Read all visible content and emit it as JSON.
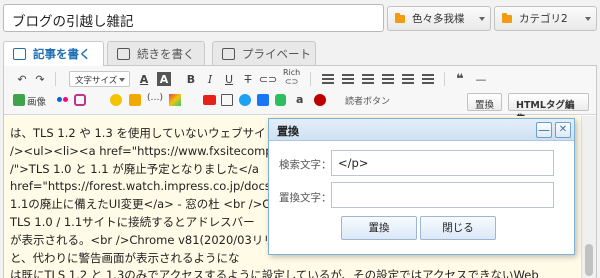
{
  "post": {
    "title": "ブログの引越し雑記"
  },
  "categories": [
    {
      "label": "色々多我楪"
    },
    {
      "label": "カテゴリ2"
    }
  ],
  "tabs": [
    {
      "label": "記事を書く"
    },
    {
      "label": "続きを書く"
    },
    {
      "label": "プライベート"
    }
  ],
  "toolbar": {
    "font_size_label": "文字サイズ",
    "rich_label": "Rich",
    "image_label": "画像",
    "reader_button_label": "読者ボタン",
    "replace_button_label": "置換",
    "html_edit_button_label": "HTMLタグ編集"
  },
  "content_lines": [
    "は、TLS 1.2 や 1.3 を使用していないウェブサイ",
    "/><ul><li><a  href=\"https://www.fxsitecompat.de",
    "/\">TLS 1.0 と 1.1 が廃止予定となりました</a",
    "href=\"https://forest.watch.impress.co.jp/docs/ne",
    "1.1の廃止に備えたUI変更</a> - 窓の杜 <br />Ch",
    "TLS 1.0 / 1.1サイトに接続するとアドレスバー",
    "が表示される。<br />Chrome v81(2020/03リリ",
    "と、代わりに警告画面が表示されるようにな",
    "は既にTLS 1.2 と 1.3のみでアクセスするように設定しているが、その設定ではアクセスできないWeb"
  ],
  "replace_dialog": {
    "title": "置換",
    "search_label": "検索文字：",
    "search_value": "</p>",
    "replace_label": "置換文字：",
    "replace_value": "",
    "replace_button": "置換",
    "close_button": "閉じる",
    "minimize_symbol": "—",
    "close_symbol": "✕"
  },
  "colors": {
    "accent_blue": "#1f6fb5",
    "folder_orange": "#f39c12",
    "content_bg": "#fffbe6"
  }
}
